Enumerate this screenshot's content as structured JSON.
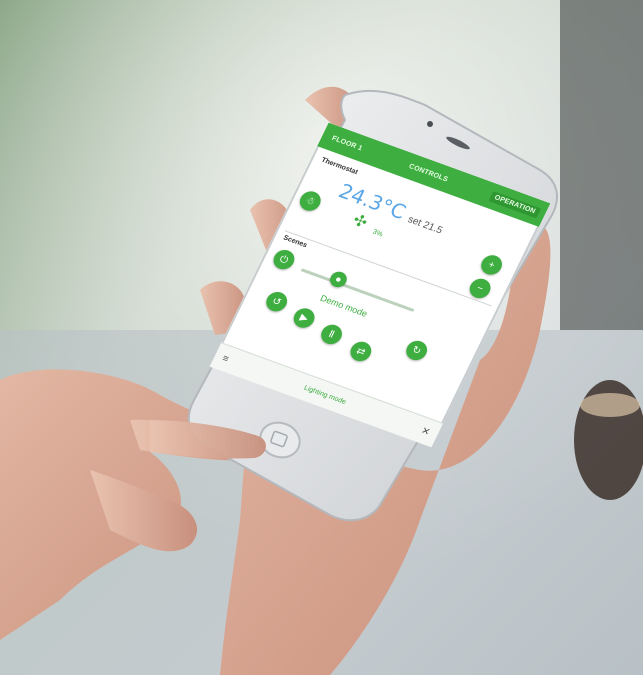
{
  "app": {
    "tabs": [
      "FLOOR 1",
      "CONTROLS",
      "OPERATION"
    ],
    "active_tab_index": 2,
    "thermostat_title": "Thermostat",
    "temperature": "24.3°C",
    "setpoint": "set 21.5",
    "fan_label": "3%",
    "scenes_title": "Scenes",
    "scene_label": "Demo mode",
    "bottom_label": "Lighting mode",
    "menu_icon": "≡",
    "close_icon": "✕"
  },
  "colors": {
    "accent_green": "#3dae3f",
    "temperature_blue": "#5aa6e6",
    "background": "#dfe4e6"
  }
}
